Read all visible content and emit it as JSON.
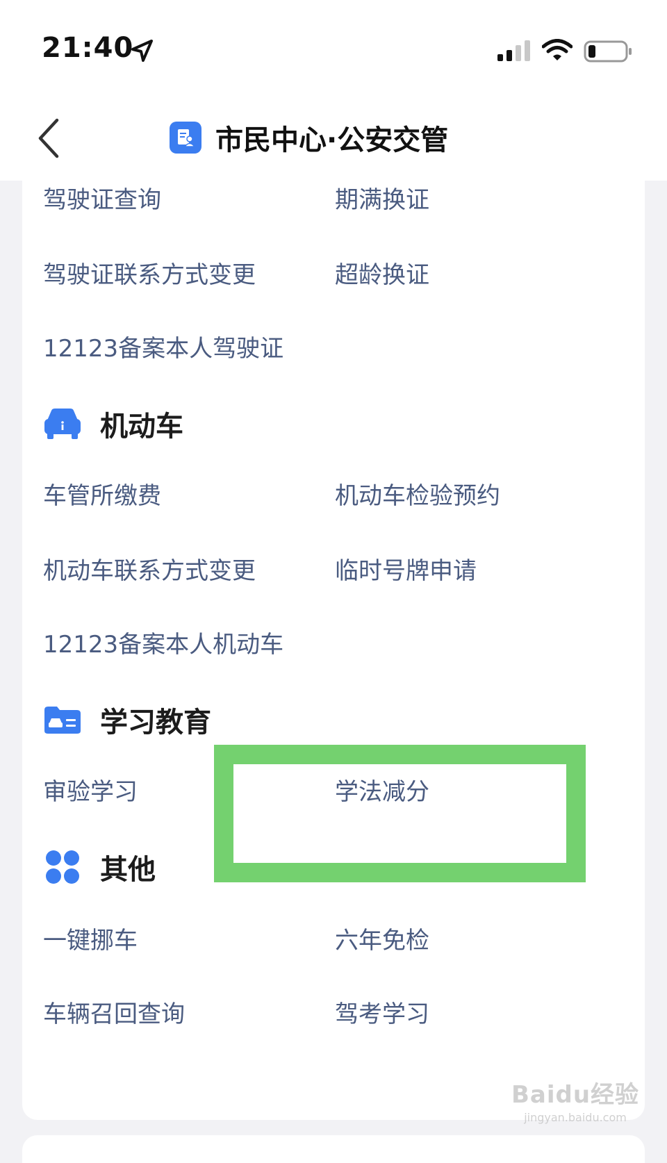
{
  "status_bar": {
    "time": "21:40"
  },
  "nav": {
    "title": "市民中心·公安交管"
  },
  "sections": {
    "license": {
      "items": [
        "驾驶证查询",
        "期满换证",
        "驾驶证联系方式变更",
        "超龄换证",
        "12123备案本人驾驶证"
      ]
    },
    "vehicle": {
      "title": "机动车",
      "items": [
        "车管所缴费",
        "机动车检验预约",
        "机动车联系方式变更",
        "临时号牌申请",
        "12123备案本人机动车"
      ]
    },
    "education": {
      "title": "学习教育",
      "items": [
        "审验学习",
        "学法减分"
      ]
    },
    "other": {
      "title": "其他",
      "items": [
        "一键挪车",
        "六年免检",
        "车辆召回查询",
        "驾考学习"
      ]
    }
  },
  "watermark": {
    "main": "Baidu经验",
    "sub": "jingyan.baidu.com"
  },
  "colors": {
    "accent": "#3b7df0",
    "item_text": "#4a5b80",
    "highlight": "#74d16f"
  }
}
